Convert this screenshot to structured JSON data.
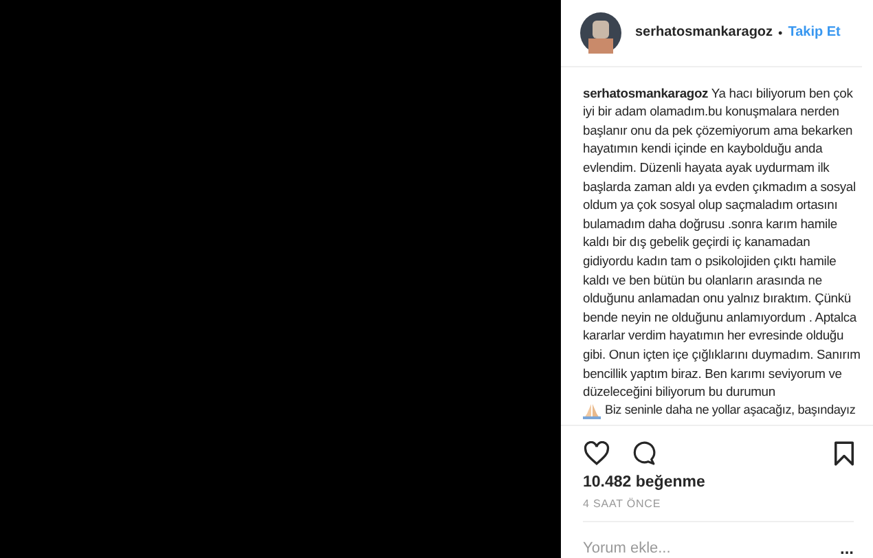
{
  "header": {
    "username": "serhatosmankaragoz",
    "separator": "•",
    "follow": "Takip Et"
  },
  "caption": {
    "username": "serhatosmankaragoz",
    "text_before": "Ya hacı biliyorum ben çok iyi bir adam olamadım.bu konuşmalara nerden başlanır onu da pek çözemiyorum ama bekarken hayatımın kendi içinde en kaybolduğu anda evlendim. Düzenli hayata ayak uydurmam ilk başlarda zaman aldı ya evden çıkmadım a sosyal oldum ya çok sosyal olup saçmaladım ortasını bulamadım daha doğrusu .sonra karım hamile kaldı bir dış gebelik geçirdi iç kanamadan gidiyordu kadın tam o psikolojiden çıktı hamile kaldı ve ben bütün bu olanların arasında ne olduğunu anlamadan onu yalnız bıraktım. Çünkü bende neyin ne olduğunu anlamıyordum . Aptalca kararlar verdim hayatımın her evresinde olduğu gibi. Onun içten içe çığlıklarını duymadım. Sanırım bencillik yaptım biraz. Ben karımı seviyorum ve düzeleceğini biliyorum bu durumun",
    "text_after": "Biz seninle daha ne yollar aşacağız, başındayız"
  },
  "actions": {
    "liked": false,
    "saved": false
  },
  "likes": "10.482 beğenme",
  "time": "4 SAAT ÖNCE",
  "comment": {
    "placeholder": "Yorum ekle...",
    "more": "..."
  }
}
